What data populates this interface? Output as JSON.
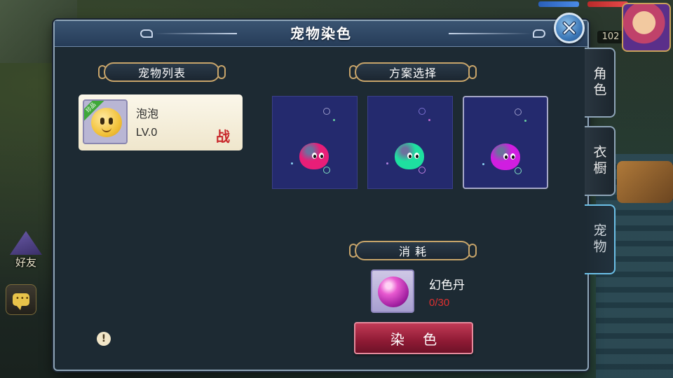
{
  "window": {
    "title": "宠物染色"
  },
  "hud": {
    "level": "102",
    "friend_label": "好友"
  },
  "pet_list": {
    "header": "宠物列表",
    "items": [
      {
        "name": "泡泡",
        "level": "LV.0",
        "battle_tag": "战",
        "rarity_ribbon": "珍品"
      }
    ]
  },
  "schemes": {
    "header": "方案选择",
    "options": [
      {
        "color": "#e81e78",
        "selected": false
      },
      {
        "color": "#1ee0a0",
        "selected": false
      },
      {
        "color": "#d01ee0",
        "selected": true
      }
    ]
  },
  "consumption": {
    "header": "消 耗",
    "material": {
      "name": "幻色丹",
      "count": "0/30",
      "color": "#e03030"
    }
  },
  "actions": {
    "dye_label": "染 色"
  },
  "side_tabs": [
    {
      "label": "角色",
      "active": false
    },
    {
      "label": "衣橱",
      "active": false
    },
    {
      "label": "宠物",
      "active": true
    }
  ],
  "icons": {
    "close": "close-icon",
    "info": "info-icon",
    "chat": "chat-icon",
    "friend": "friend-hat-icon"
  },
  "colors": {
    "accent_gold": "#c7a46a",
    "dye_button": "#a82444",
    "panel_bg": "#1d2a33"
  }
}
